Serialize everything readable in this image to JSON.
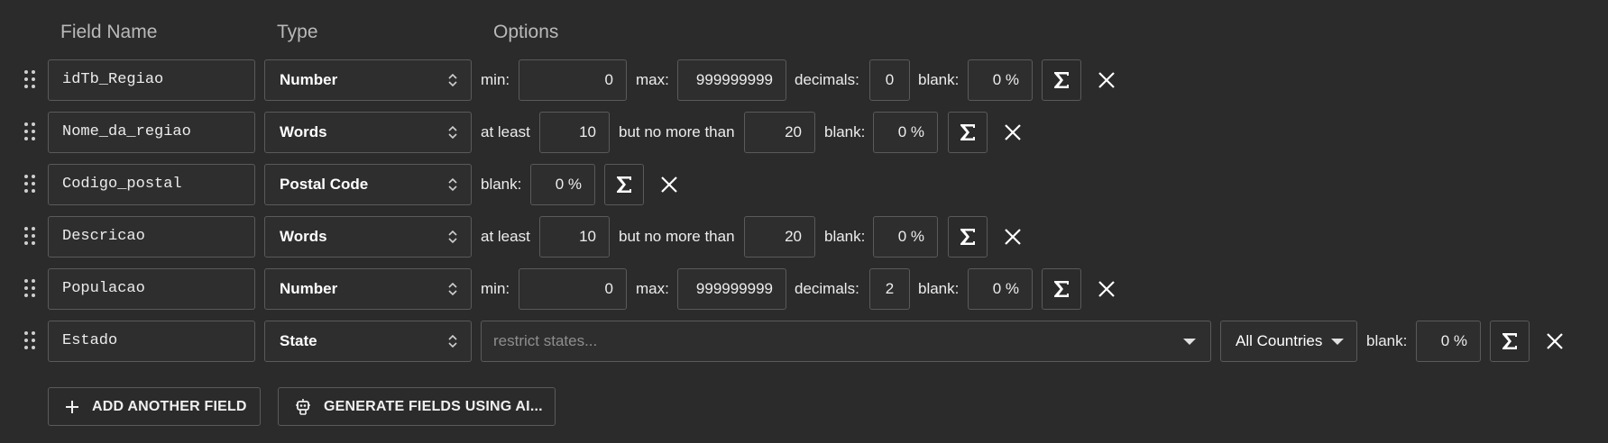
{
  "header": {
    "field_name": "Field Name",
    "type": "Type",
    "options": "Options"
  },
  "rows": [
    {
      "name": "idTb_Regiao",
      "type": "Number",
      "min_label": "min:",
      "min": "0",
      "max_label": "max:",
      "max": "999999999",
      "decimals_label": "decimals:",
      "decimals": "0",
      "blank_label": "blank:",
      "blank": "0 %"
    },
    {
      "name": "Nome_da_regiao",
      "type": "Words",
      "atleast_label": "at least",
      "atleast": "10",
      "nomore_label": "but no more than",
      "nomore": "20",
      "blank_label": "blank:",
      "blank": "0 %"
    },
    {
      "name": "Codigo_postal",
      "type": "Postal Code",
      "blank_label": "blank:",
      "blank": "0 %"
    },
    {
      "name": "Descricao",
      "type": "Words",
      "atleast_label": "at least",
      "atleast": "10",
      "nomore_label": "but no more than",
      "nomore": "20",
      "blank_label": "blank:",
      "blank": "0 %"
    },
    {
      "name": "Populacao",
      "type": "Number",
      "min_label": "min:",
      "min": "0",
      "max_label": "max:",
      "max": "999999999",
      "decimals_label": "decimals:",
      "decimals": "2",
      "blank_label": "blank:",
      "blank": "0 %"
    },
    {
      "name": "Estado",
      "type": "State",
      "restrict_placeholder": "restrict states...",
      "countries": "All Countries",
      "blank_label": "blank:",
      "blank": "0 %"
    }
  ],
  "icons": {
    "drag": "drag-handle-icon",
    "sigma": "sigma-icon",
    "close": "close-icon",
    "chevron": "up-down-chevron-icon",
    "caret": "caret-down-icon",
    "plus": "plus-icon",
    "robot": "robot-icon"
  },
  "buttons": {
    "add_field": "ADD ANOTHER FIELD",
    "generate_ai": "GENERATE FIELDS USING AI..."
  },
  "colors": {
    "background": "#2b2b2b",
    "border": "#5a5a5a",
    "text": "#e6e6e6",
    "header_text": "#b9b9b9",
    "placeholder": "#8e8e8e"
  }
}
